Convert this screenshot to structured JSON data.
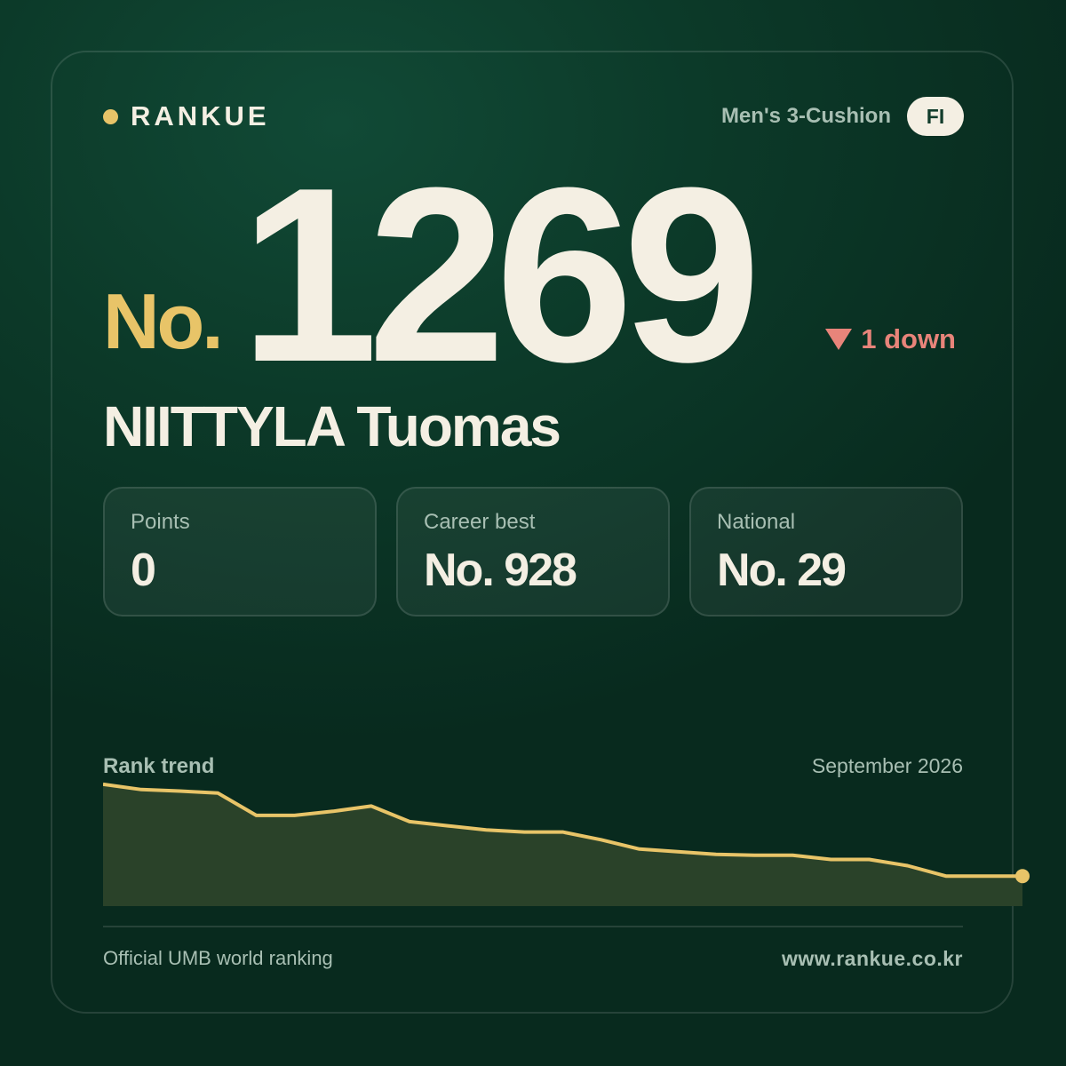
{
  "brand": {
    "name": "RANKUE"
  },
  "header": {
    "category": "Men's 3-Cushion",
    "country_code": "FI"
  },
  "ranking": {
    "prefix": "No.",
    "rank": "1269",
    "change_text": "1 down",
    "change_direction": "down",
    "player_name": "NIITTYLA Tuomas"
  },
  "stats": [
    {
      "label": "Points",
      "value": "0"
    },
    {
      "label": "Career best",
      "value": "No. 928"
    },
    {
      "label": "National",
      "value": "No. 29"
    }
  ],
  "trend": {
    "title": "Rank trend",
    "date": "September 2026"
  },
  "chart_data": {
    "type": "area",
    "title": "Rank trend",
    "xlabel": "",
    "ylabel": "",
    "grid": false,
    "legend": "none",
    "ylim": [
      1040,
      1280
    ],
    "series": [
      {
        "values": [
          1045,
          1055,
          1058,
          1062,
          1105,
          1105,
          1097,
          1087,
          1117,
          1125,
          1133,
          1137,
          1137,
          1152,
          1170,
          1175,
          1180,
          1182,
          1182,
          1190,
          1190,
          1202,
          1222,
          1222,
          1222
        ]
      }
    ]
  },
  "footer": {
    "source": "Official UMB world ranking",
    "website": "www.rankue.co.kr"
  },
  "colors": {
    "accent": "#e8c468",
    "text": "#f4efe3",
    "muted": "#a8bfb3",
    "down": "#e8847a",
    "area_fill": "#2a4229"
  }
}
